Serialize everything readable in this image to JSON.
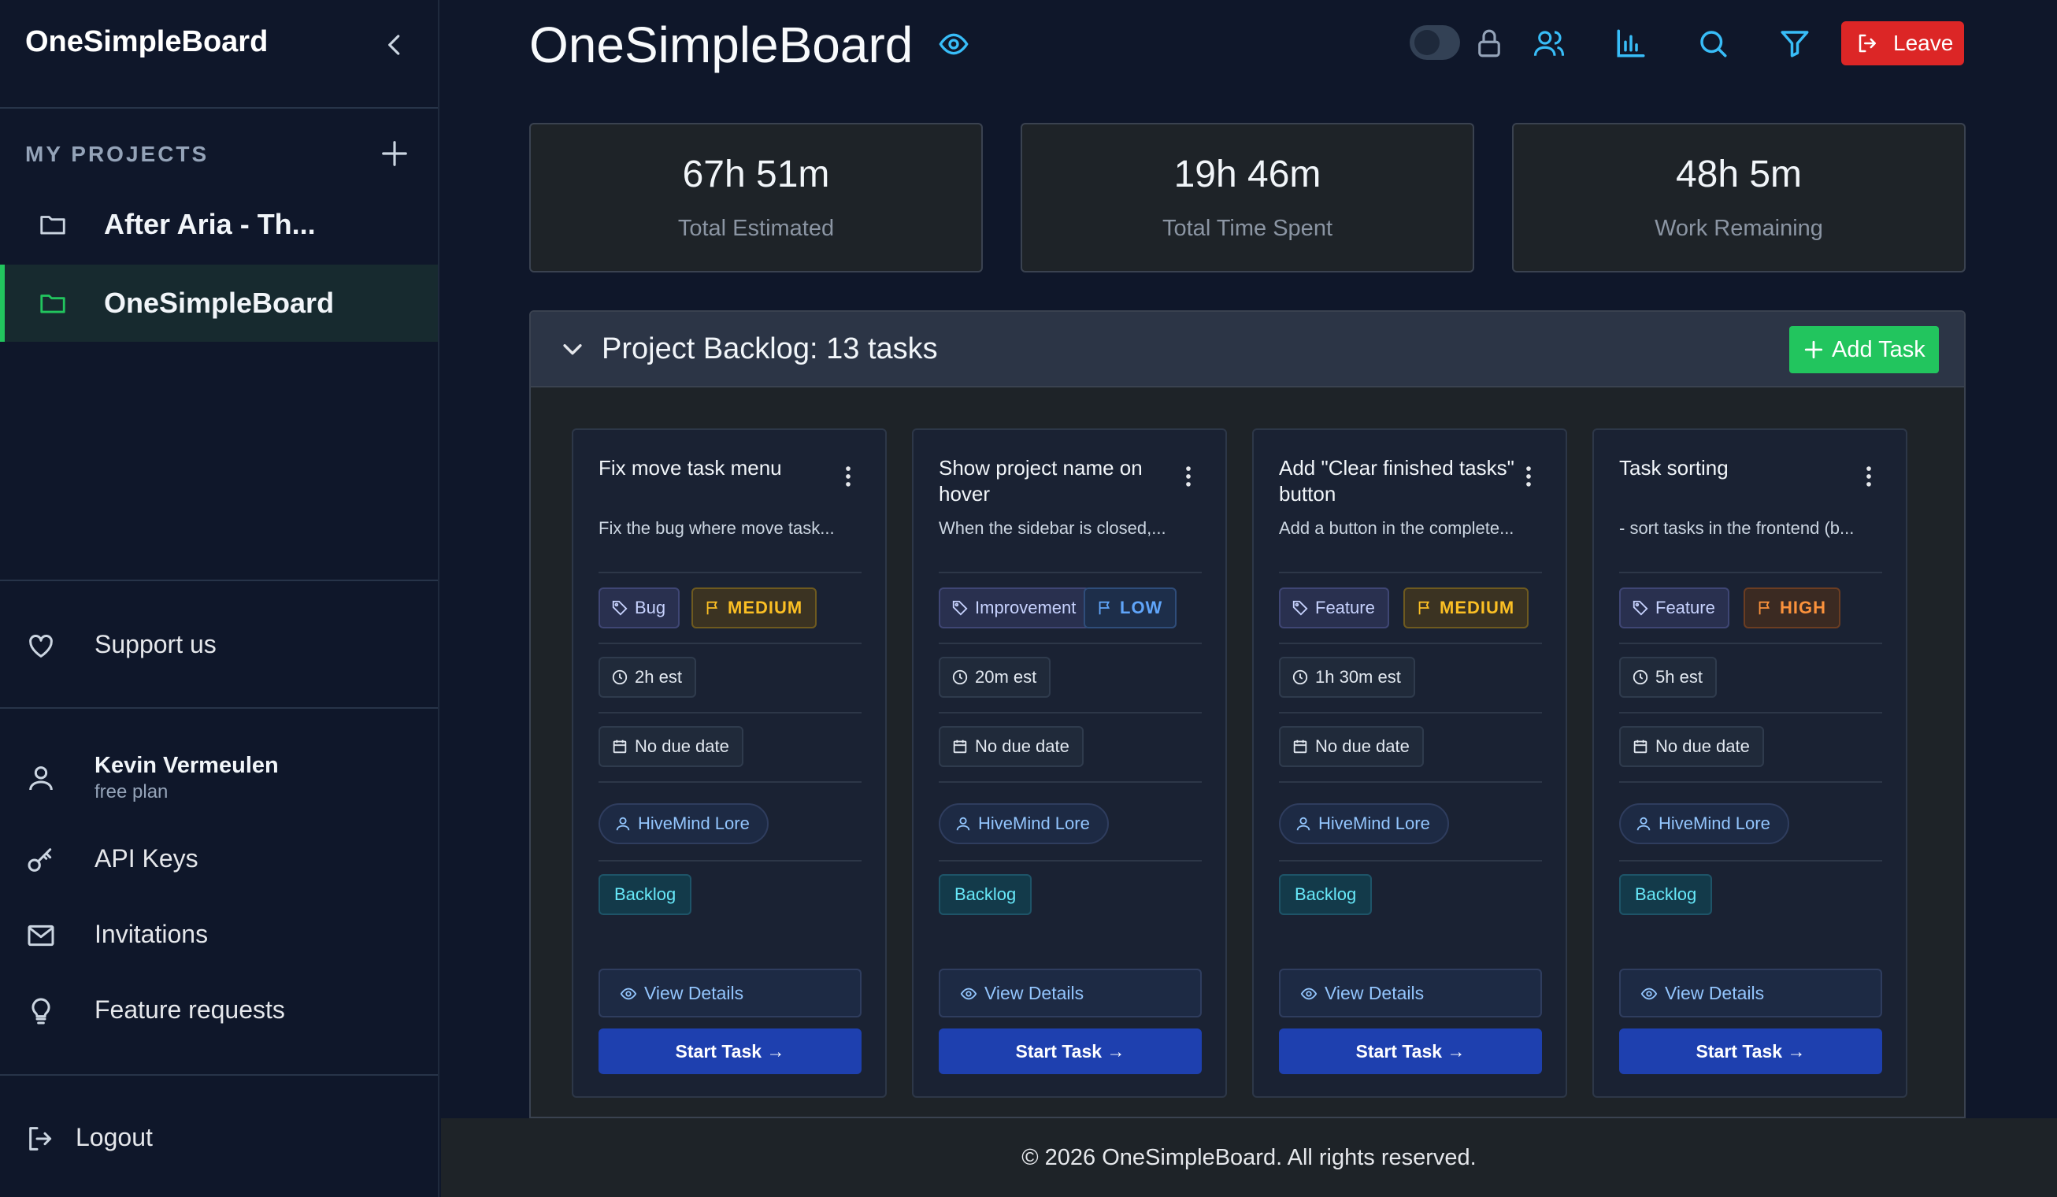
{
  "sidebar": {
    "app_title": "OneSimpleBoard",
    "section_label": "MY PROJECTS",
    "projects": [
      {
        "label": "After Aria - Th..."
      },
      {
        "label": "OneSimpleBoard",
        "active": true
      }
    ],
    "support_label": "Support us",
    "user": {
      "name": "Kevin Vermeulen",
      "plan": "free plan"
    },
    "menu": [
      {
        "label": "API Keys",
        "icon": "key-icon"
      },
      {
        "label": "Invitations",
        "icon": "mail-icon"
      },
      {
        "label": "Feature requests",
        "icon": "lightbulb-icon"
      }
    ],
    "logout_label": "Logout"
  },
  "header": {
    "title": "OneSimpleBoard",
    "leave_label": "Leave",
    "accent_color": "#38bdf8",
    "leave_color": "#dc2626"
  },
  "stats": [
    {
      "value": "67h 51m",
      "label": "Total Estimated"
    },
    {
      "value": "19h 46m",
      "label": "Total Time Spent"
    },
    {
      "value": "48h 5m",
      "label": "Work Remaining"
    }
  ],
  "backlog": {
    "title": "Project Backlog: 13 tasks",
    "add_task_label": "Add Task",
    "tasks": [
      {
        "title": "Fix move task menu",
        "description": "Fix the bug where move task...",
        "tag": "Bug",
        "priority": "MEDIUM",
        "estimate": "2h est",
        "due": "No due date",
        "assignee": "HiveMind Lore",
        "status": "Backlog",
        "view_label": "View Details",
        "start_label": "Start Task →"
      },
      {
        "title": "Show project name on hover",
        "description": "When the sidebar is closed,...",
        "tag": "Improvement",
        "priority": "LOW",
        "estimate": "20m est",
        "due": "No due date",
        "assignee": "HiveMind Lore",
        "status": "Backlog",
        "view_label": "View Details",
        "start_label": "Start Task →"
      },
      {
        "title": "Add \"Clear finished tasks\" button",
        "description": "Add a button in the complete...",
        "tag": "Feature",
        "priority": "MEDIUM",
        "estimate": "1h 30m est",
        "due": "No due date",
        "assignee": "HiveMind Lore",
        "status": "Backlog",
        "view_label": "View Details",
        "start_label": "Start Task →"
      },
      {
        "title": "Task sorting",
        "description": "- sort tasks in the frontend (b...",
        "tag": "Feature",
        "priority": "HIGH",
        "estimate": "5h est",
        "due": "No due date",
        "assignee": "HiveMind Lore",
        "status": "Backlog",
        "view_label": "View Details",
        "start_label": "Start Task →"
      }
    ]
  },
  "footer": {
    "text": "© 2026 OneSimpleBoard. All rights reserved."
  }
}
